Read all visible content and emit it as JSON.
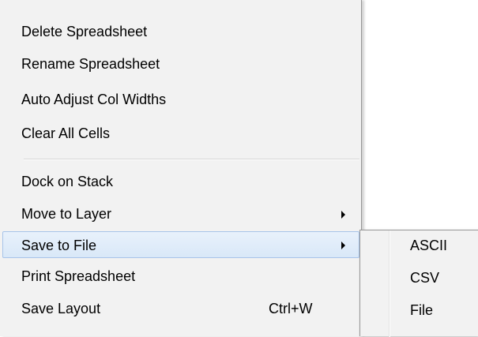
{
  "menu": {
    "items": [
      {
        "label": "Delete Spreadsheet"
      },
      {
        "label": "Rename Spreadsheet"
      },
      {
        "label": "Auto Adjust Col Widths"
      },
      {
        "label": "Clear All Cells"
      },
      {
        "label": "Dock on Stack"
      },
      {
        "label": "Move to Layer"
      },
      {
        "label": "Save to File"
      },
      {
        "label": "Print Spreadsheet"
      },
      {
        "label": "Save Layout",
        "shortcut": "Ctrl+W"
      }
    ]
  },
  "submenu": {
    "items": [
      {
        "label": "ASCII"
      },
      {
        "label": "CSV"
      },
      {
        "label": "File"
      }
    ]
  },
  "colors": {
    "menu_background": "#f2f2f2",
    "highlight_border": "#a7c4e9",
    "highlight_fill": "#dce9f8"
  }
}
